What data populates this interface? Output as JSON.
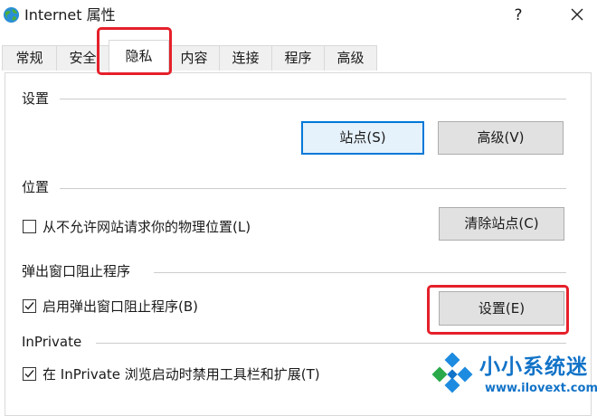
{
  "window": {
    "title": "Internet 属性",
    "help_label": "?"
  },
  "tabs": [
    {
      "label": "常规",
      "active": false
    },
    {
      "label": "安全",
      "active": false
    },
    {
      "label": "隐私",
      "active": true
    },
    {
      "label": "内容",
      "active": false
    },
    {
      "label": "连接",
      "active": false
    },
    {
      "label": "程序",
      "active": false
    },
    {
      "label": "高级",
      "active": false
    }
  ],
  "settings_group": {
    "label": "设置",
    "sites_button": "站点(S)",
    "advanced_button": "高级(V)"
  },
  "location_group": {
    "label": "位置",
    "checkbox_label": "从不允许网站请求你的物理位置(L)",
    "checked": false,
    "clear_button": "清除站点(C)"
  },
  "popup_group": {
    "label": "弹出窗口阻止程序",
    "checkbox_label": "启用弹出窗口阻止程序(B)",
    "checked": true,
    "settings_button": "设置(E)"
  },
  "inprivate_group": {
    "label": "InPrivate",
    "checkbox_label": "在 InPrivate 浏览启动时禁用工具栏和扩展(T)",
    "checked": true
  },
  "watermark": {
    "brand": "小小系统迷",
    "url": "www.ilovext.com"
  },
  "colors": {
    "highlight": "#e5202a",
    "default_button_border": "#0078d7",
    "watermark_blue": "#1273c8"
  }
}
